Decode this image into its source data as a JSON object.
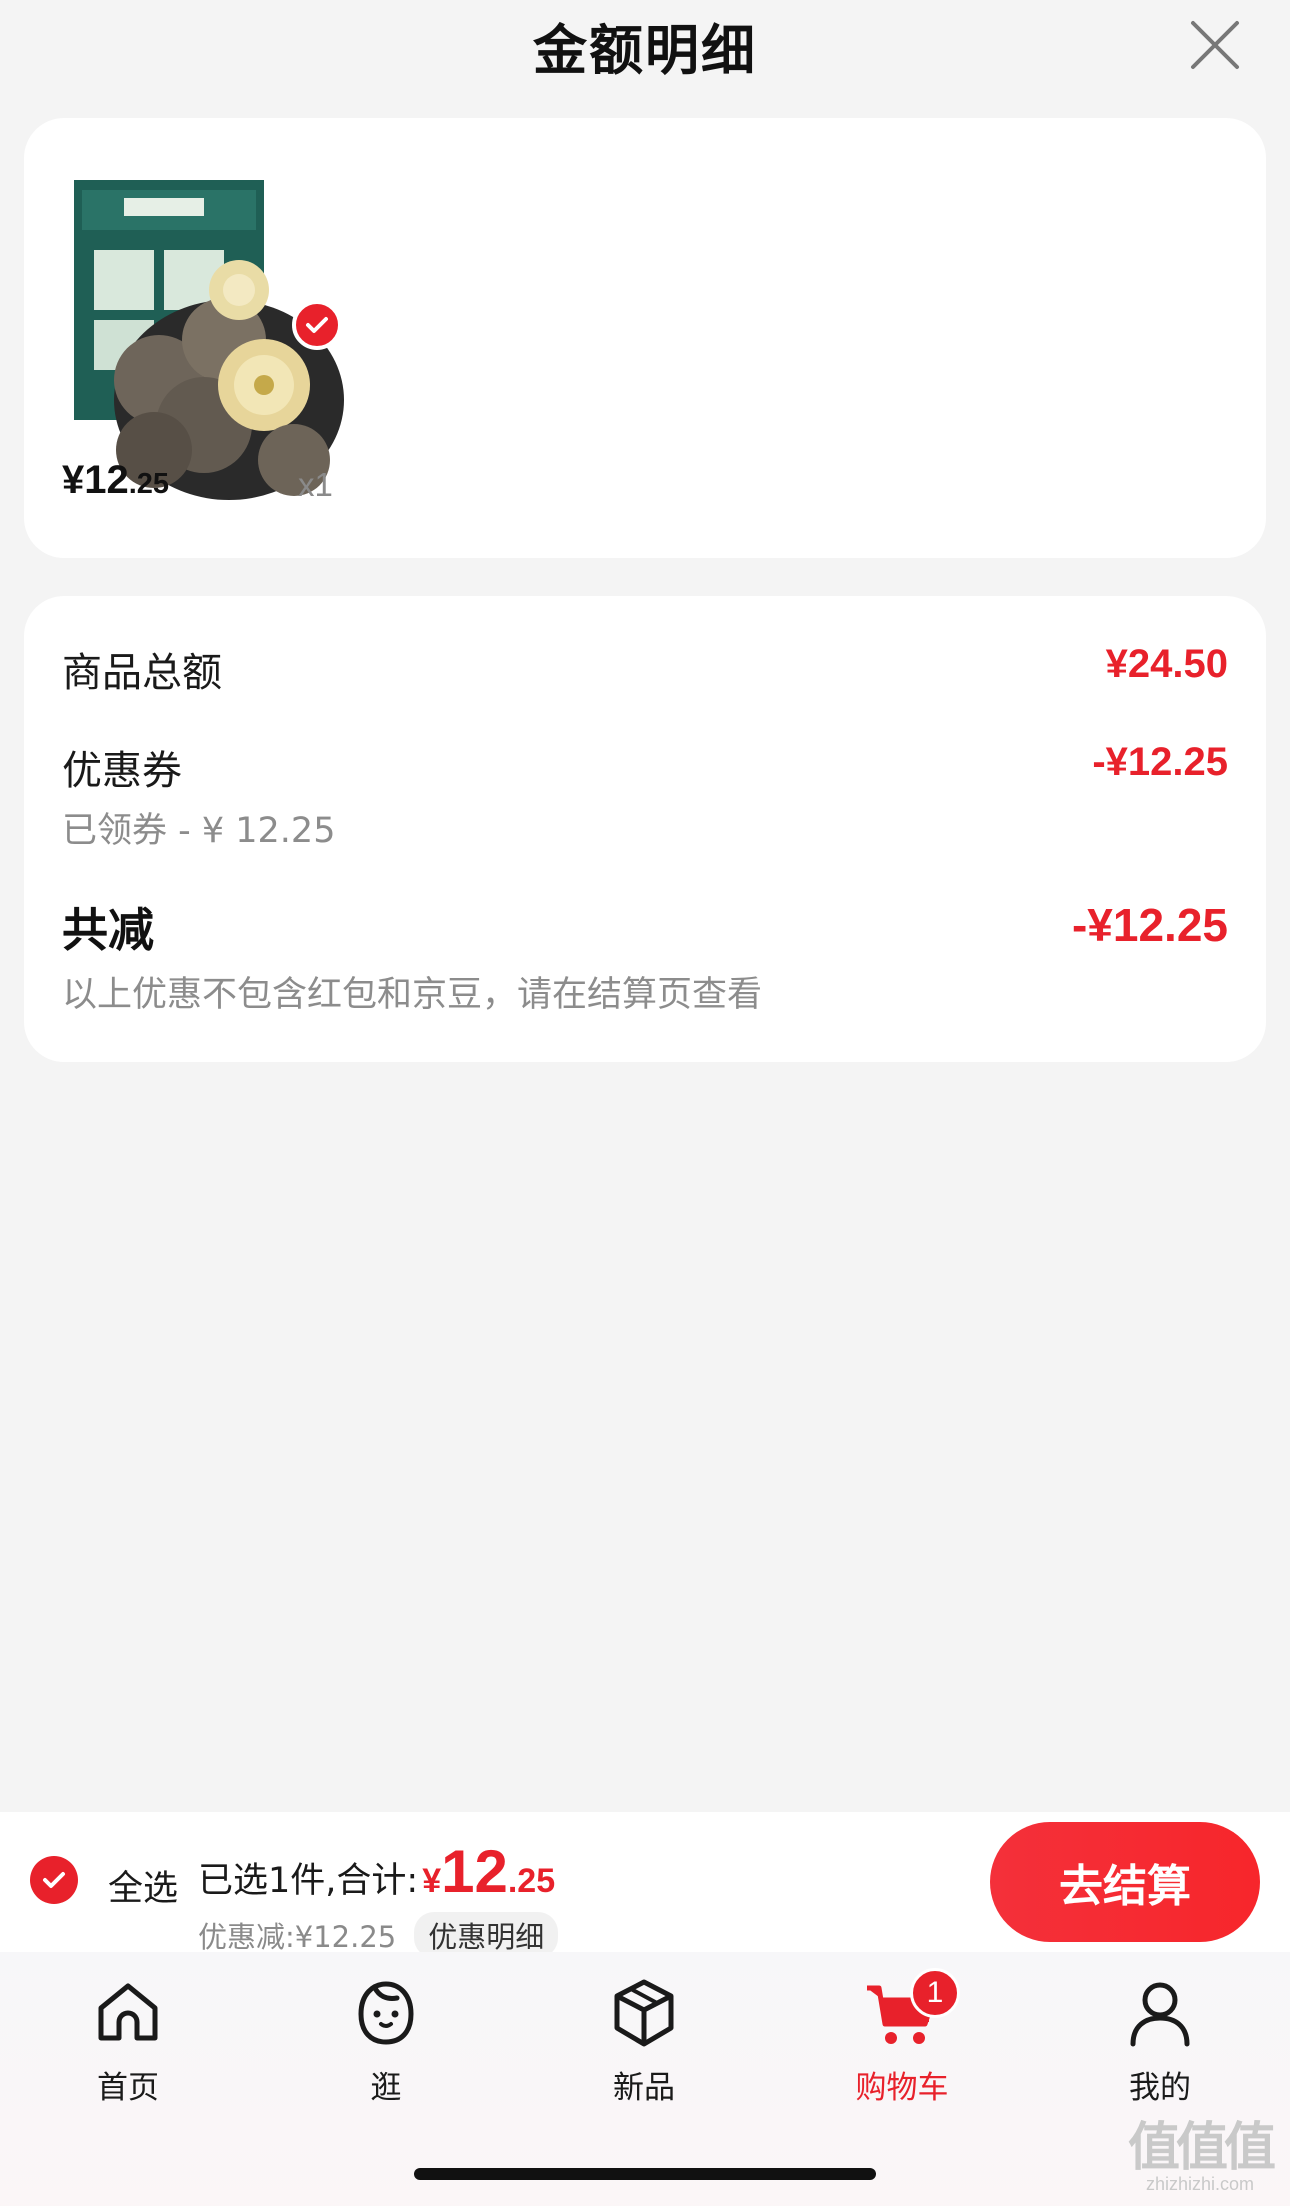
{
  "header": {
    "title": "金额明细"
  },
  "product": {
    "price_int": "¥12",
    "price_dec": ".25",
    "quantity": "x1",
    "selected": true
  },
  "summary": {
    "goods_total_label": "商品总额",
    "goods_total_value": "¥24.50",
    "coupon_label": "优惠券",
    "coupon_value": "-¥12.25",
    "coupon_sub": "已领券 - ¥ 12.25",
    "total_reduce_label": "共减",
    "total_reduce_value": "-¥12.25",
    "note": "以上优惠不包含红包和京豆，请在结算页查看"
  },
  "checkout": {
    "select_all_label": "全选",
    "selected_text": "已选1件,合计:",
    "total_currency": "¥",
    "total_int": "12",
    "total_dec": ".25",
    "discount_text": "优惠减:¥12.25",
    "detail_chip": "优惠明细",
    "button_label": "去结算"
  },
  "tabs": [
    {
      "label": "首页",
      "icon": "home-icon"
    },
    {
      "label": "逛",
      "icon": "face-icon"
    },
    {
      "label": "新品",
      "icon": "cube-icon"
    },
    {
      "label": "购物车",
      "icon": "cart-icon",
      "active": true,
      "badge": "1"
    },
    {
      "label": "我的",
      "icon": "user-icon"
    }
  ],
  "watermark": {
    "glyphs": "值值值",
    "site": "zhizhizhi.com"
  },
  "colors": {
    "accent": "#e8212b",
    "background": "#f4f4f4"
  }
}
